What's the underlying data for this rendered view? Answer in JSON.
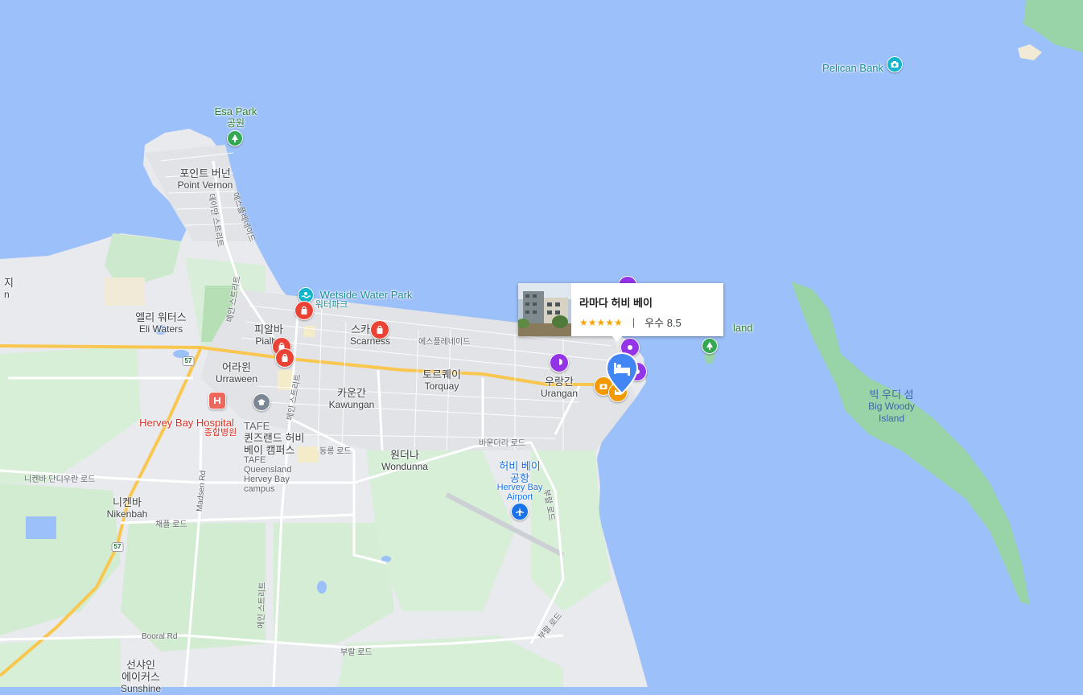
{
  "map": {
    "water_color": "#9cc0f9",
    "land_color": "#e8eaed",
    "park_color": "#c5e8c5",
    "island_color": "#99d3a8"
  },
  "places": {
    "esa_park": {
      "name": "Esa Park",
      "sub": "공원",
      "icon": "tree-icon"
    },
    "point_vernon": {
      "ko": "포인트 버넌",
      "en": "Point Vernon"
    },
    "eli_waters": {
      "ko": "엘리 워터스",
      "en": "Eli Waters"
    },
    "pialba": {
      "ko": "피알바",
      "en": "Pialba"
    },
    "scarness": {
      "ko": "스카니스",
      "en": "Scarness"
    },
    "urraween": {
      "ko": "어라윈",
      "en": "Urraween"
    },
    "torquay": {
      "ko": "토르퀘이",
      "en": "Torquay"
    },
    "kawungan": {
      "ko": "카운간",
      "en": "Kawungan"
    },
    "urangan": {
      "ko": "우랑간",
      "en": "Urangan"
    },
    "wondunna": {
      "ko": "원더나",
      "en": "Wondunna"
    },
    "nikenbah": {
      "ko": "니켄바",
      "en": "Nikenbah"
    },
    "sunshine": {
      "ko1": "선샤인",
      "ko2": "에이커스",
      "en": "Sunshine"
    },
    "big_woody": {
      "ko": "빅 우디 섬",
      "en1": "Big Woody",
      "en2": "Island"
    },
    "pelican_bank": {
      "name": "Pelican Bank",
      "icon": "camera-icon"
    },
    "wetside": {
      "name": "Wetside Water Park",
      "sub": "워터파크",
      "icon": "water-park-icon"
    },
    "hospital": {
      "name": "Hervey Bay Hospital",
      "sub": "종합병원",
      "icon": "hospital-icon"
    },
    "tafe": {
      "ko1": "TAFE",
      "ko2": "퀸즈랜드 허비",
      "ko3": "베이 캠퍼스",
      "en1": "TAFE",
      "en2": "Queensland",
      "en3": "Hervey Bay",
      "en4": "campus",
      "icon": "school-icon"
    },
    "airport": {
      "ko1": "허비 베이",
      "ko2": "공항",
      "en1": "Hervey Bay",
      "en2": "Airport",
      "icon": "airplane-icon"
    },
    "island_partial": {
      "name": "land",
      "icon": "tree-icon"
    },
    "edge_left": {
      "l1": "지",
      "l2": "n"
    }
  },
  "roads": {
    "esplanade_ko": "에스플레네이드",
    "esplanade_top": "에스플레네이드",
    "main_st": "메인 스트리트",
    "madsen": "Madsen Rd",
    "chapel": "채플 로드",
    "nikenbah_rd": "니켄바 단디우란 로드",
    "dungong": "동롱 로드",
    "boundary": "바운더리 로드",
    "booral": "Booral Rd",
    "bural": "부랄 로드",
    "bural2": "부랄 로드",
    "bural3": "부랄 로드",
    "main_st2": "메인 스트리트",
    "main_st3": "메인 스트리트",
    "dayman": "데이만 스트리트",
    "esplanade_pv": "에스플레네이드",
    "hwy": "57",
    "hwy2": "57"
  },
  "card": {
    "name": "라마다 허비 베이",
    "stars": "★★★★★",
    "separator": "|",
    "rating_text": "우수 8.5",
    "icon": "hotel-bed-icon"
  }
}
